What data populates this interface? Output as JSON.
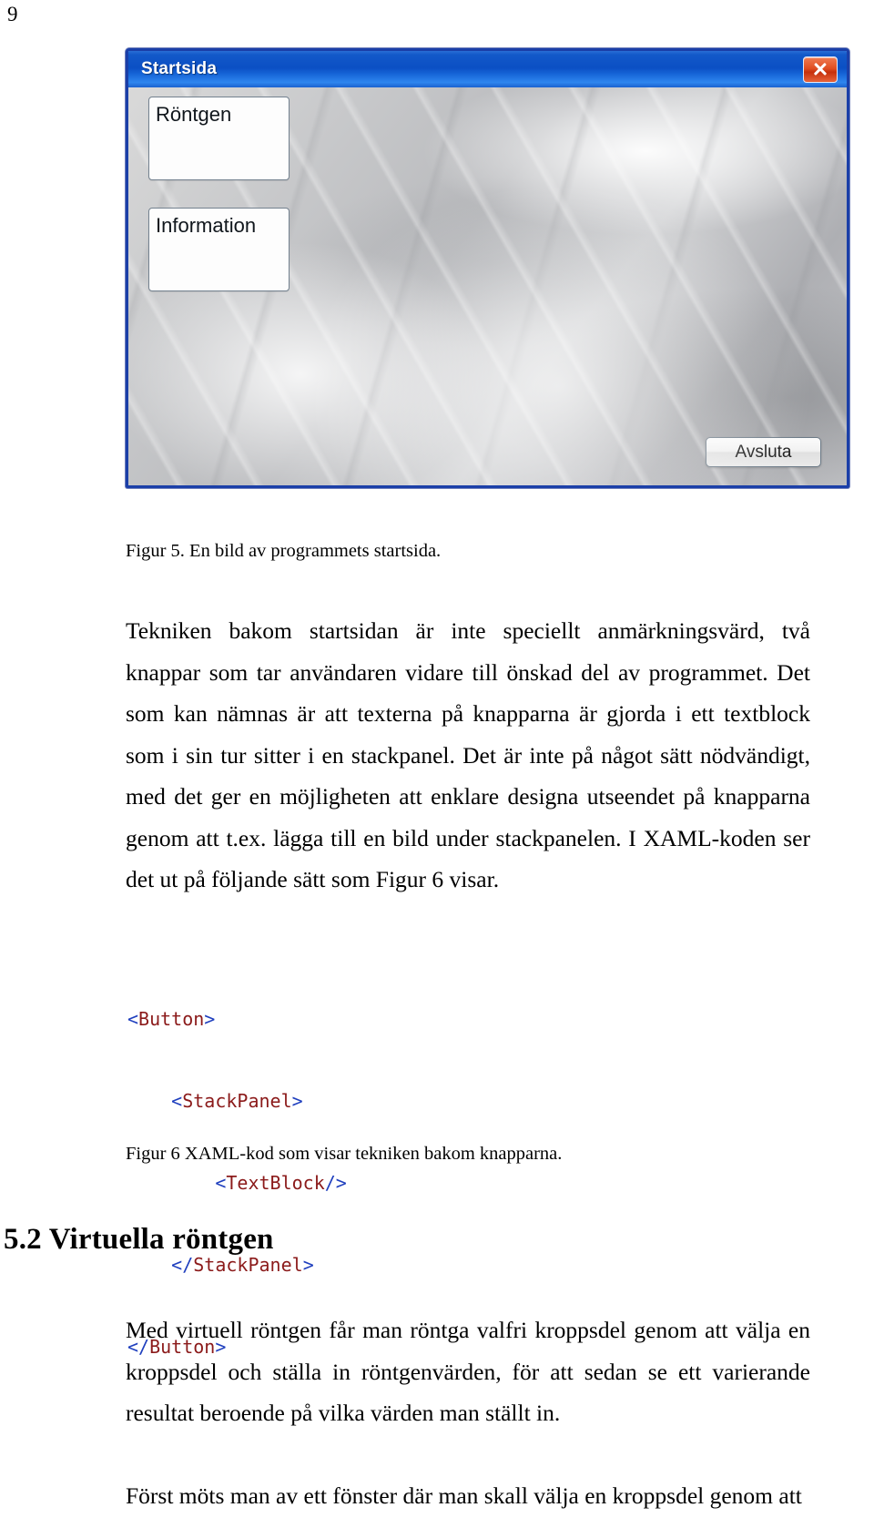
{
  "page": {
    "number": "9"
  },
  "figure5": {
    "caption": "Figur 5. En bild av programmets startsida.",
    "window": {
      "title": "Startsida",
      "close_icon": "close-icon",
      "close_color": "#d8441c",
      "titlebar_color": "#0b4fc4",
      "buttons": [
        {
          "label": "Röntgen"
        },
        {
          "label": "Information"
        }
      ],
      "exit_label": "Avsluta"
    }
  },
  "paragraphs": {
    "p1": "Tekniken bakom startsidan är inte speciellt anmärkningsvärd, två knappar som tar användaren vidare till önskad del av programmet. Det som kan nämnas är att texterna på knapparna är gjorda i ett textblock som i sin tur sitter i en stackpanel. Det är inte på något sätt nödvändigt, med det ger en möjligheten att enklare designa utseendet på knapparna genom att t.ex. lägga till en bild under stackpanelen. I XAML-koden ser det ut på följande sätt som Figur 6 visar.",
    "p2": "Med virtuell röntgen får man röntga valfri kroppsdel genom att välja en kroppsdel och ställa in röntgenvärden, för att sedan se ett varierande resultat beroende på vilka värden man ställt in.",
    "p3": "Först möts man av ett fönster där man skall välja en kroppsdel genom att"
  },
  "code": {
    "lines": [
      {
        "indent": 0,
        "text": "<Button>"
      },
      {
        "indent": 1,
        "text": "<StackPanel>"
      },
      {
        "indent": 2,
        "text": "<TextBlock/>"
      },
      {
        "indent": 1,
        "text": "</StackPanel>"
      },
      {
        "indent": 0,
        "text": "</Button>"
      }
    ],
    "punctuation_color": "#1f3fbe",
    "tag_color": "#8b1a1a"
  },
  "figure6": {
    "caption": "Figur 6 XAML-kod som visar tekniken bakom knapparna."
  },
  "heading": {
    "text": "5.2 Virtuella röntgen"
  }
}
